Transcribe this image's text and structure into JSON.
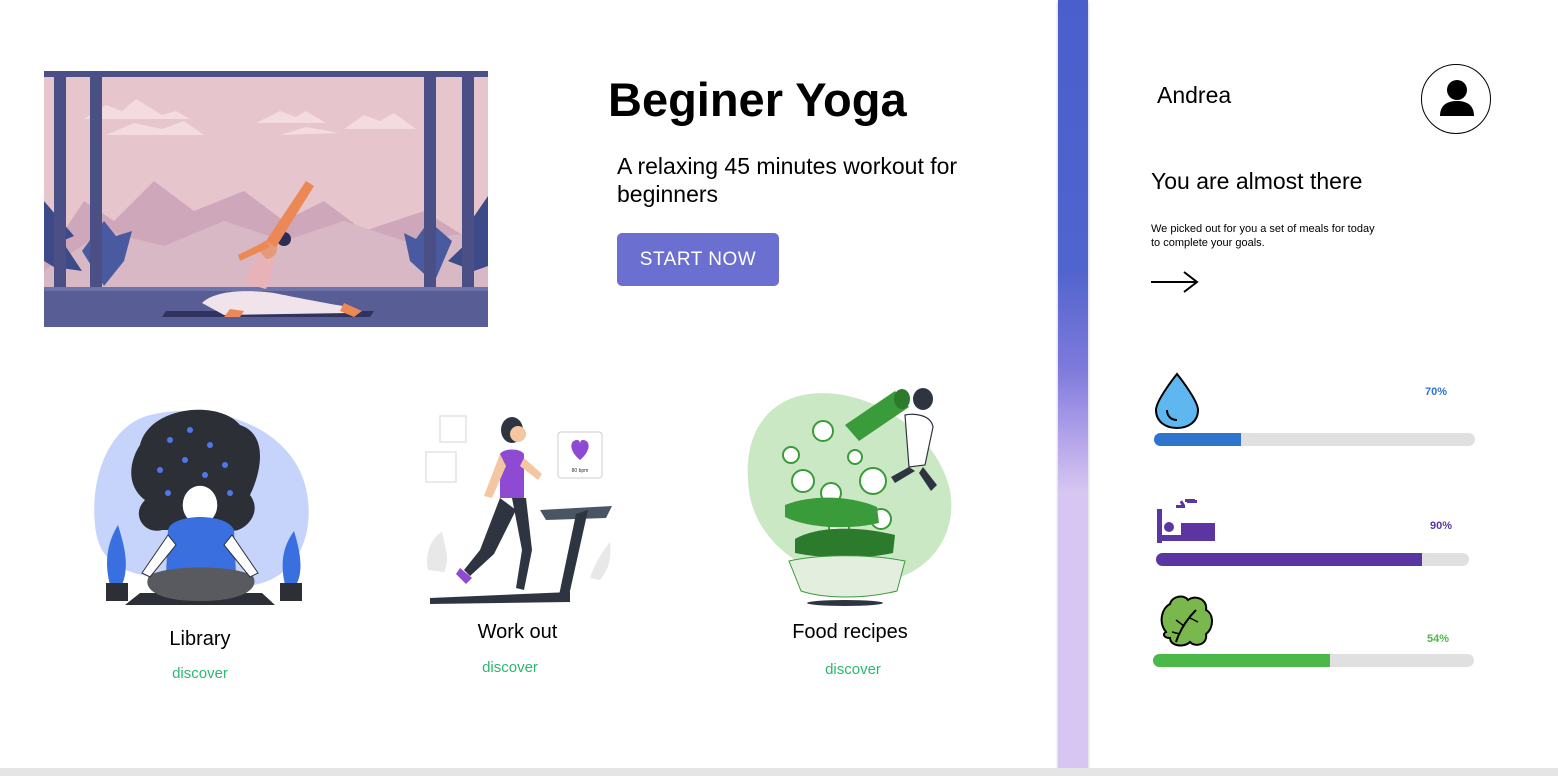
{
  "hero": {
    "title": "Beginer Yoga",
    "subtitle": "A relaxing 45 minutes workout for beginners",
    "cta_label": "START NOW"
  },
  "cards": [
    {
      "title": "Library",
      "link": "discover",
      "illustration": "meditation-illustration"
    },
    {
      "title": "Work out",
      "link": "discover",
      "illustration": "treadmill-illustration",
      "badge_text": "80 bpm"
    },
    {
      "title": "Food recipes",
      "link": "discover",
      "illustration": "salad-illustration"
    }
  ],
  "panel": {
    "user_name": "Andrea",
    "heading": "You are almost there",
    "text": "We picked out for you a set of meals for today to complete your goals.",
    "goals": [
      {
        "icon": "water-drop-icon",
        "label": "70%",
        "fraction": 0.27,
        "color": "#2f74cc"
      },
      {
        "icon": "sleep-icon",
        "label": "90%",
        "fraction": 0.85,
        "color": "#5b36a3"
      },
      {
        "icon": "lettuce-icon",
        "label": "54%",
        "fraction": 0.55,
        "color": "#4cb84a"
      }
    ]
  },
  "colors": {
    "accent": "#6a6fd0",
    "link": "#2bb870",
    "divider_top": "#4a5fcc",
    "divider_bottom": "#d6c6f1"
  }
}
